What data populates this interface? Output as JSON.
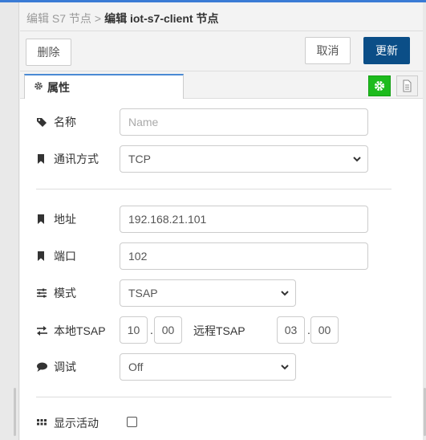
{
  "breadcrumb": {
    "prev": "编辑 S7 节点",
    "sep": ">",
    "current": "编辑 iot-s7-client 节点"
  },
  "toolbar": {
    "delete_label": "删除",
    "cancel_label": "取消",
    "update_label": "更新"
  },
  "tabs": {
    "properties_label": "属性"
  },
  "form": {
    "name": {
      "label": "名称",
      "placeholder": "Name",
      "value": ""
    },
    "comm_method": {
      "label": "通讯方式",
      "value": "TCP"
    },
    "address": {
      "label": "地址",
      "value": "192.168.21.101"
    },
    "port": {
      "label": "端口",
      "value": "102"
    },
    "mode": {
      "label": "模式",
      "value": "TSAP"
    },
    "local_tsap": {
      "label": "本地TSAP",
      "part1": "10",
      "dot": ".",
      "part2": "00"
    },
    "remote_tsap": {
      "label": "远程TSAP",
      "part1": "03",
      "dot": ".",
      "part2": "00"
    },
    "debug": {
      "label": "调试",
      "value": "Off"
    },
    "show_activity": {
      "label": "显示活动",
      "checked": false
    }
  },
  "colors": {
    "update_button": "#0b4e87",
    "cog_tab": "#1dbb1d",
    "top_strip": "#3a7bd5"
  },
  "icons": {
    "properties_tab": "cog-icon",
    "name": "tag-icon",
    "comm_method": "bookmark-icon",
    "address": "bookmark-icon",
    "port": "bookmark-icon",
    "mode": "sliders-icon",
    "local_tsap": "exchange-icon",
    "debug": "comment-icon",
    "show_activity": "grid-icon"
  }
}
